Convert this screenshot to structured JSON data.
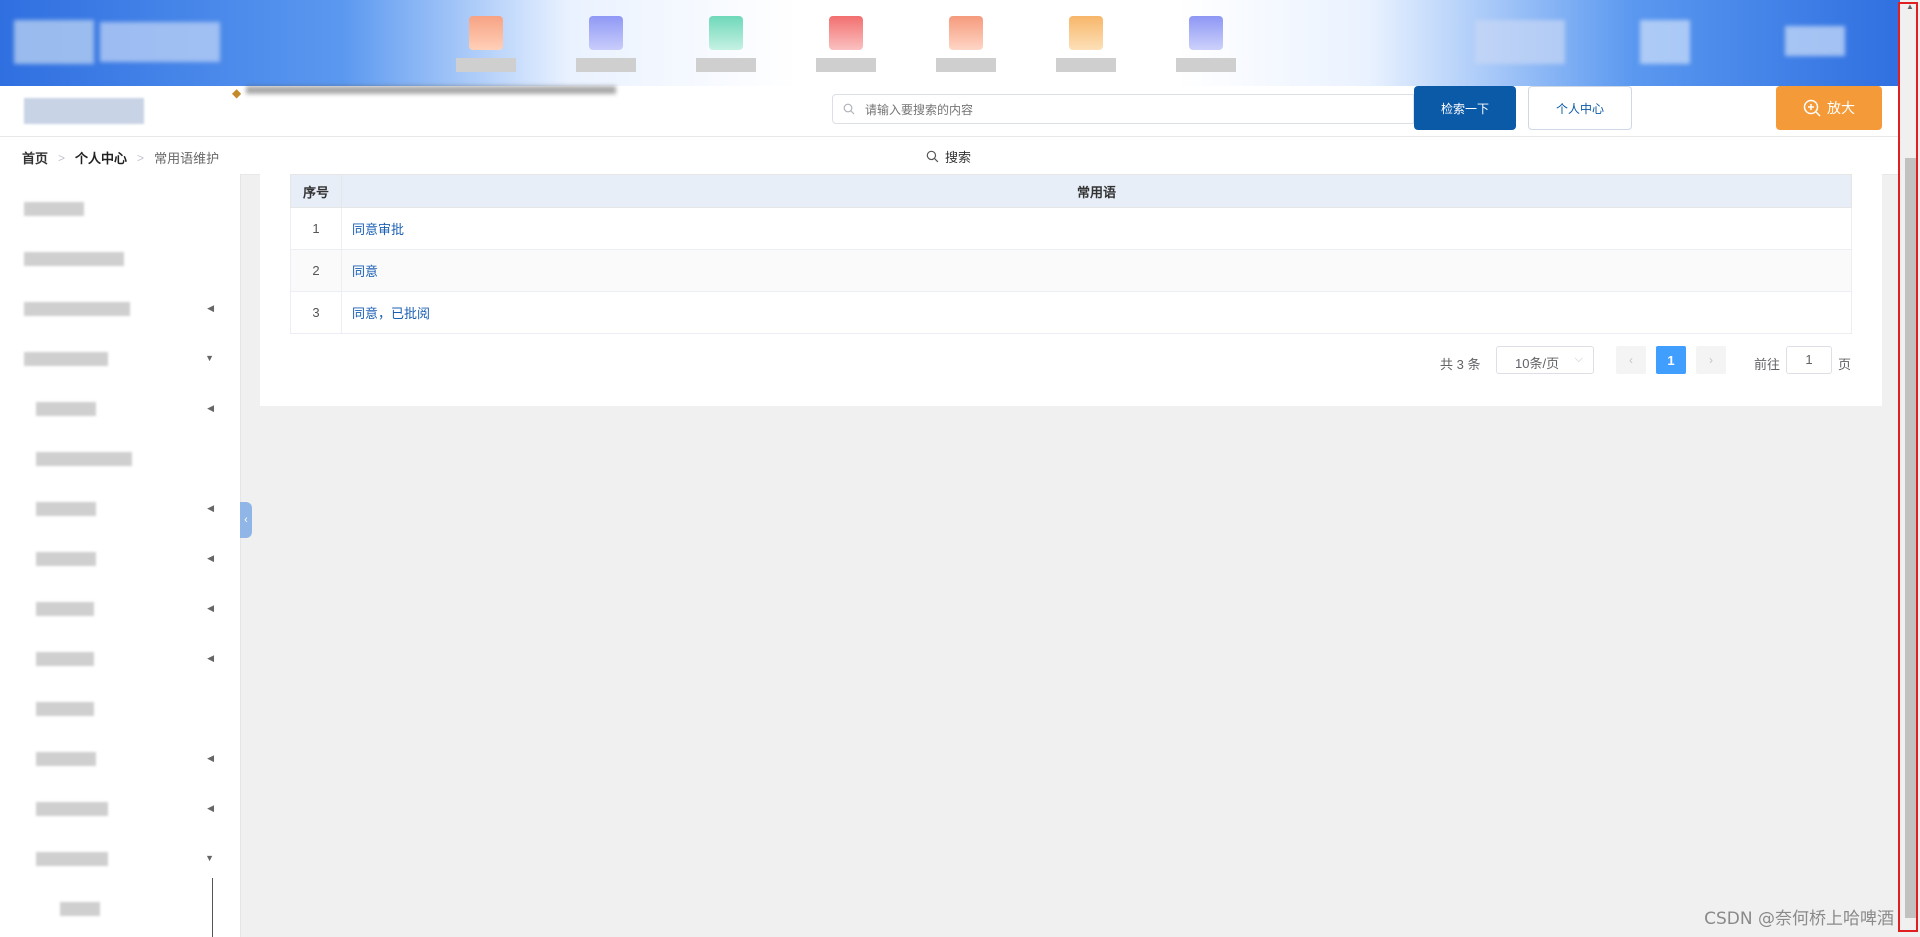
{
  "header": {
    "search_placeholder": "请输入要搜索的内容",
    "search_button": "检索一下",
    "personal_center_button": "个人中心",
    "zoom_button": "放大"
  },
  "breadcrumb": {
    "home": "首页",
    "parent": "个人中心",
    "current": "常用语维护"
  },
  "toolbar": {
    "search_label": "搜索"
  },
  "table": {
    "columns": [
      "序号",
      "常用语"
    ],
    "rows": [
      {
        "index": "1",
        "phrase": "同意审批"
      },
      {
        "index": "2",
        "phrase": "同意"
      },
      {
        "index": "3",
        "phrase": "同意，已批阅"
      }
    ]
  },
  "pagination": {
    "total": "共 3 条",
    "page_size": "10条/页",
    "current_page": "1",
    "goto_prefix": "前往",
    "goto_value": "1",
    "goto_suffix": "页"
  },
  "watermark": "CSDN @奈何桥上哈啤酒",
  "colors": {
    "primary": "#0b5aa8",
    "accent": "#f59a38",
    "page_active": "#409eff",
    "highlight": "#e02020"
  }
}
